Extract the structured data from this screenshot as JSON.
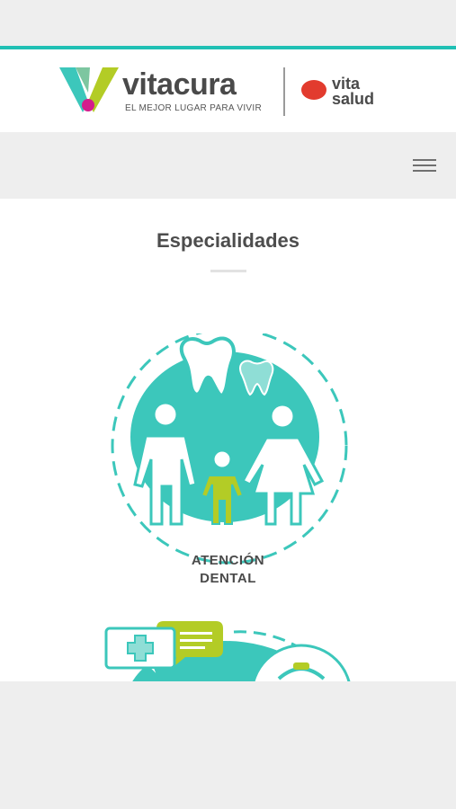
{
  "header": {
    "brand": "vitacura",
    "tagline": "EL MEJOR LUGAR PARA VIVIR",
    "partner_line1": "vita",
    "partner_line2": "salud"
  },
  "nav": {
    "menu_icon": "hamburger-menu-icon"
  },
  "main": {
    "title": "Especialidades",
    "specialties": [
      {
        "line1": "ATENCIÓN",
        "line2": "DENTAL",
        "icon": "dental-family-icon"
      },
      {
        "icon": "medical-chat-icon"
      }
    ]
  },
  "colors": {
    "accent": "#20c0b4",
    "teal": "#3cc7bb",
    "lime": "#b3cc26",
    "magenta": "#d41c8c",
    "red": "#e23b2e",
    "text": "#4a4a4a"
  }
}
